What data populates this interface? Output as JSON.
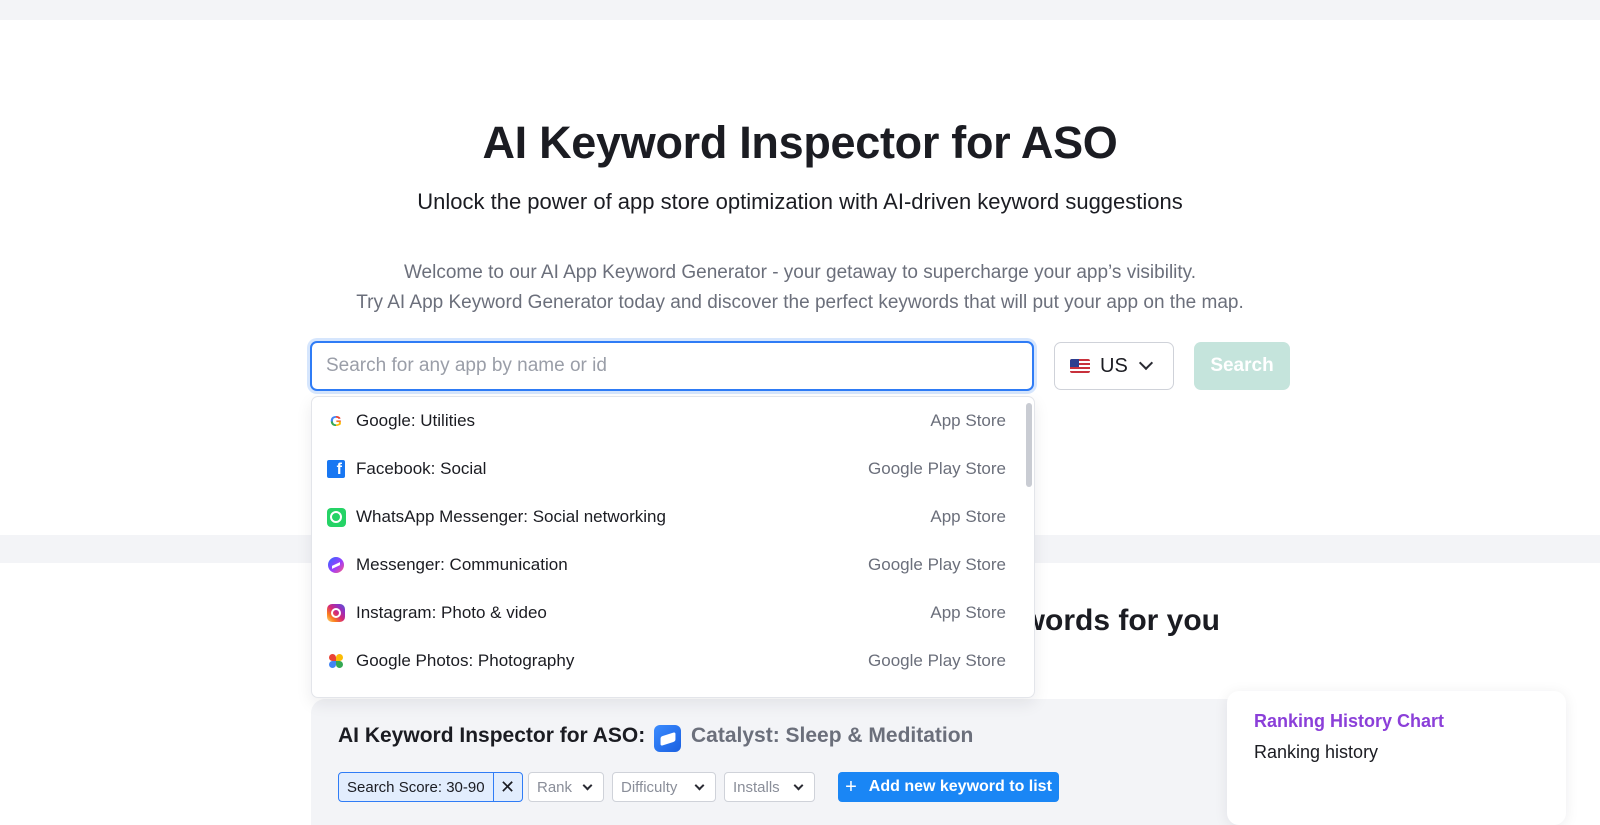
{
  "hero": {
    "title": "AI Keyword Inspector for ASO",
    "subtitle": "Unlock the power of app store optimization with AI-driven keyword suggestions",
    "desc_line1": "Welcome to our AI App Keyword Generator - your getaway to supercharge your app’s visibility.",
    "desc_line2": "Try AI App Keyword Generator today and discover the perfect keywords that will put your app on the map."
  },
  "search": {
    "placeholder": "Search for any app by name or id",
    "value": "",
    "country": "US",
    "button_label": "Search"
  },
  "suggestions": [
    {
      "name": "Google: Utilities",
      "store": "App Store",
      "icon": "google-icon"
    },
    {
      "name": "Facebook: Social",
      "store": "Google Play Store",
      "icon": "facebook-icon"
    },
    {
      "name": "WhatsApp Messenger: Social networking",
      "store": "App Store",
      "icon": "whatsapp-icon"
    },
    {
      "name": "Messenger: Communication",
      "store": "Google Play Store",
      "icon": "messenger-icon"
    },
    {
      "name": "Instagram: Photo & video",
      "store": "App Store",
      "icon": "instagram-icon"
    },
    {
      "name": "Google Photos: Photography",
      "store": "Google Play Store",
      "icon": "google-photos-icon"
    }
  ],
  "section": {
    "heading_visible": "words for you"
  },
  "card": {
    "title": "AI Keyword Inspector for ASO:",
    "app_name": "Catalyst: Sleep & Meditation",
    "filter_chip": "Search Score: 30-90",
    "filter_close": "✕",
    "selects": [
      "Rank",
      "Difficulty",
      "Installs"
    ],
    "add_button": "Add new keyword to list",
    "add_icon": "+"
  },
  "side_card": {
    "title": "Ranking History Chart",
    "subtitle": "Ranking history"
  },
  "colors": {
    "accent": "#2f7cf6",
    "primary_button": "#1a86f5",
    "search_button_disabled": "#c5e4dc",
    "side_title": "#8b3fd9"
  }
}
